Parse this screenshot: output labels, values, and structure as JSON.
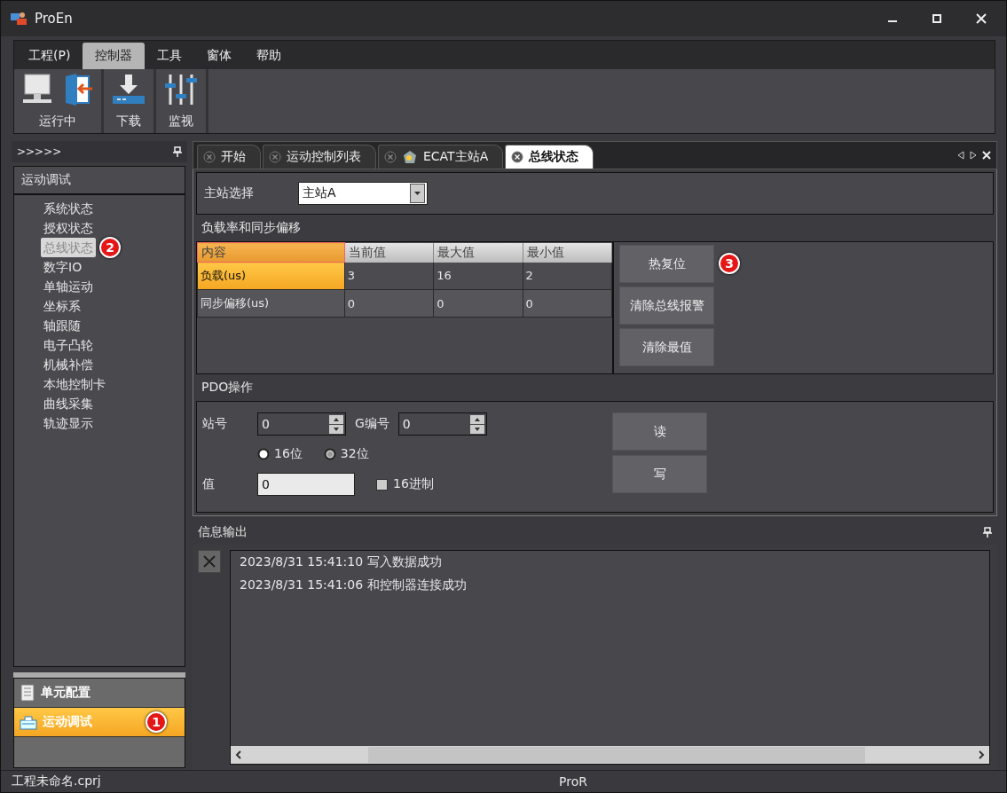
{
  "window": {
    "title": "ProEn"
  },
  "menu": [
    {
      "label": "工程(P)",
      "selected": false
    },
    {
      "label": "控制器",
      "selected": true
    },
    {
      "label": "工具",
      "selected": false
    },
    {
      "label": "窗体",
      "selected": false
    },
    {
      "label": "帮助",
      "selected": false
    }
  ],
  "ribbon": [
    {
      "label": "运行中",
      "kind": "run"
    },
    {
      "label": "下载",
      "kind": "download"
    },
    {
      "label": "监视",
      "kind": "monitor"
    }
  ],
  "sidebar": {
    "header": ">>>>>",
    "section": "运动调试",
    "items": [
      {
        "label": "系统状态",
        "selected": false
      },
      {
        "label": "授权状态",
        "selected": false
      },
      {
        "label": "总线状态",
        "selected": true,
        "callout": "2"
      },
      {
        "label": "数字IO",
        "selected": false
      },
      {
        "label": "单轴运动",
        "selected": false
      },
      {
        "label": "坐标系",
        "selected": false
      },
      {
        "label": "轴跟随",
        "selected": false
      },
      {
        "label": "电子凸轮",
        "selected": false
      },
      {
        "label": "机械补偿",
        "selected": false
      },
      {
        "label": "本地控制卡",
        "selected": false
      },
      {
        "label": "曲线采集",
        "selected": false
      },
      {
        "label": "轨迹显示",
        "selected": false
      }
    ],
    "nav": [
      {
        "label": "单元配置",
        "selected": false,
        "kind": "config"
      },
      {
        "label": "运动调试",
        "selected": true,
        "kind": "debug",
        "callout": "1"
      }
    ]
  },
  "tabs": [
    {
      "label": "开始",
      "selected": false,
      "kind": "page"
    },
    {
      "label": "运动控制列表",
      "selected": false,
      "kind": "page"
    },
    {
      "label": "ECAT主站A",
      "selected": false,
      "kind": "device"
    },
    {
      "label": "总线状态",
      "selected": true,
      "kind": "page"
    }
  ],
  "master": {
    "label": "主站选择",
    "value": "主站A"
  },
  "load": {
    "title": "负载率和同步偏移",
    "columns": [
      "内容",
      "当前值",
      "最大值",
      "最小值"
    ],
    "rows": [
      {
        "cells": [
          "负载(us)",
          "3",
          "16",
          "2"
        ],
        "selected": true
      },
      {
        "cells": [
          "同步偏移(us)",
          "0",
          "0",
          "0"
        ],
        "selected": false
      }
    ],
    "buttons": [
      {
        "label": "热复位",
        "callout": "3"
      },
      {
        "label": "清除总线报警"
      },
      {
        "label": "清除最值"
      }
    ]
  },
  "pdo": {
    "title": "PDO操作",
    "station": {
      "label": "站号",
      "value": "0"
    },
    "group": {
      "label": "G编号",
      "value": "0"
    },
    "radios": [
      {
        "label": "16位",
        "selected": false
      },
      {
        "label": "32位",
        "selected": true
      }
    ],
    "value": {
      "label": "值",
      "value": "0"
    },
    "hex": {
      "label": "16进制",
      "checked": false
    },
    "buttons": [
      "读",
      "写"
    ]
  },
  "output": {
    "title": "信息输出",
    "messages": [
      "2023/8/31  15:41:10 写入数据成功",
      "2023/8/31  15:41:06 和控制器连接成功"
    ]
  },
  "status_bar": {
    "file": "工程未命名.cprj",
    "center": "ProR"
  }
}
